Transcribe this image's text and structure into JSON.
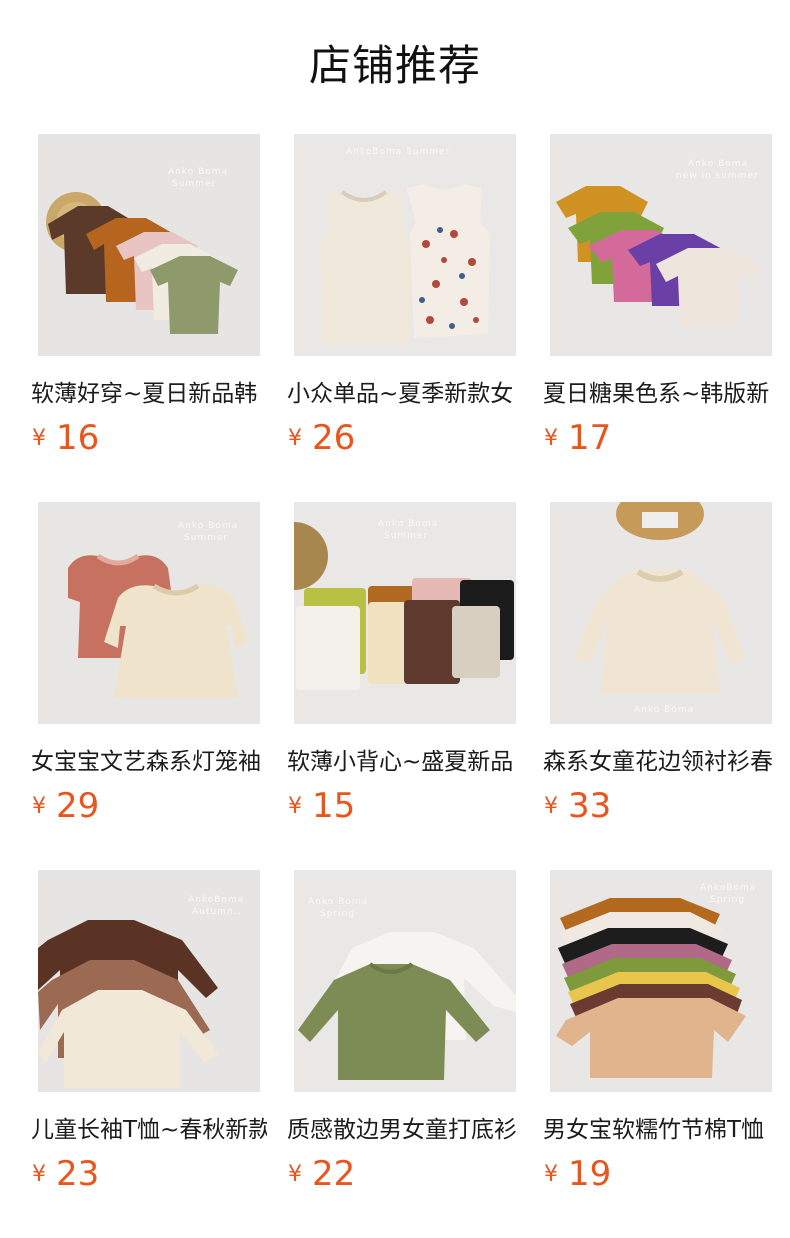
{
  "page_title": "店铺推荐",
  "currency_symbol": "¥",
  "products": [
    {
      "name": "软薄好穿~夏日新品韩",
      "price": "16",
      "watermark": "Anko Boma Summer"
    },
    {
      "name": "小众单品~夏季新款女",
      "price": "26",
      "watermark": "AnkoBoma Summer"
    },
    {
      "name": "夏日糖果色系~韩版新",
      "price": "17",
      "watermark": "Anko Boma new in summer"
    },
    {
      "name": "女宝宝文艺森系灯笼袖",
      "price": "29",
      "watermark": "Anko Boma Summer"
    },
    {
      "name": "软薄小背心~盛夏新品",
      "price": "15",
      "watermark": "Anko Boma Summer"
    },
    {
      "name": "森系女童花边领衬衫春",
      "price": "33",
      "watermark": "Anko Boma"
    },
    {
      "name": "儿童长袖T恤~春秋新款",
      "price": "23",
      "watermark": "AnkoBoma Autumn.."
    },
    {
      "name": "质感散边男女童打底衫",
      "price": "22",
      "watermark": "Anko Boma Spring"
    },
    {
      "name": "男女宝软糯竹节棉T恤",
      "price": "19",
      "watermark": "AnkoBoma Spring"
    }
  ],
  "colors": {
    "price": "#e8561e",
    "background_photo": "#e6e5e3"
  }
}
